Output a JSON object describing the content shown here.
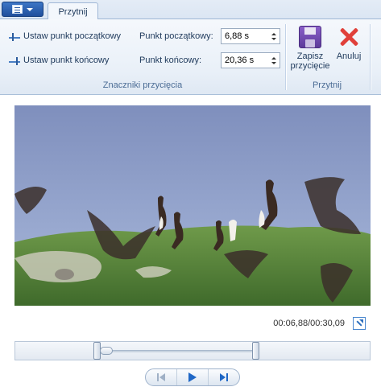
{
  "ribbon": {
    "active_tab": "Przytnij",
    "groups": {
      "markers": {
        "set_start_label": "Ustaw punkt początkowy",
        "set_end_label": "Ustaw punkt końcowy",
        "start_point_label": "Punkt początkowy:",
        "start_point_value": "6,88 s",
        "end_point_label": "Punkt końcowy:",
        "end_point_value": "20,36 s",
        "group_label": "Znaczniki przycięcia"
      },
      "trim": {
        "save_label_line1": "Zapisz",
        "save_label_line2": "przycięcie",
        "cancel_label": "Anuluj",
        "group_label": "Przytnij"
      }
    }
  },
  "player": {
    "time_readout": "00:06,88/00:30,09",
    "trim_start_fraction": 0.2287,
    "trim_end_fraction": 0.6768,
    "position_fraction": 0.2287
  },
  "icons": {
    "app_menu": "app-menu-icon",
    "set_start": "start-marker-icon",
    "set_end": "end-marker-icon",
    "save": "save-icon",
    "cancel": "cancel-icon",
    "expand": "expand-icon",
    "prev": "previous-frame-icon",
    "play": "play-icon",
    "next": "next-frame-icon"
  },
  "colors": {
    "accent": "#1f67c6",
    "cancel": "#e0403a",
    "save": "#6b46b0"
  }
}
